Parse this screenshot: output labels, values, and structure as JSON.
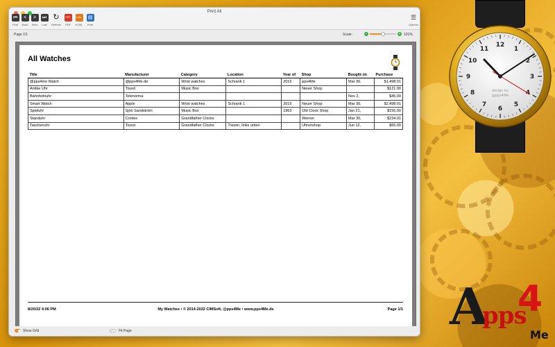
{
  "window": {
    "title": "Print All"
  },
  "toolbar": {
    "buttons": [
      {
        "label": "First",
        "icon": "first-page-icon",
        "glyph": "⏮"
      },
      {
        "label": "Back",
        "icon": "previous-page-icon",
        "glyph": "<"
      },
      {
        "label": "Next",
        "icon": "next-page-icon",
        "glyph": ">"
      },
      {
        "label": "Last",
        "icon": "last-page-icon",
        "glyph": "⏭"
      },
      {
        "label": "Refresh",
        "icon": "refresh-icon",
        "glyph": "↻"
      },
      {
        "label": "PDF",
        "icon": "pdf-icon",
        "glyph": "PDF"
      },
      {
        "label": "HTML",
        "icon": "html-icon",
        "glyph": "HTML"
      },
      {
        "label": "Print",
        "icon": "printer-icon",
        "glyph": "▤"
      }
    ],
    "options_label": "Options"
  },
  "infobar": {
    "page_label": "Page  1/1",
    "scale_label": "Scale:",
    "zoom_minus": "−",
    "zoom_plus": "+",
    "zoom_level": 101,
    "zoom_value": "101%"
  },
  "report": {
    "title": "All Watches",
    "columns": [
      "Title",
      "Manufacturer",
      "Category",
      "Location",
      "Year of",
      "Shop",
      "Bought on",
      "Purchase"
    ],
    "rows": [
      [
        "@pps4me Watch",
        "@pps4Me.de",
        "Wrist watches",
        "Schrank 1",
        "2015",
        "pps4Me",
        "Mar 30,",
        "$1,498.01"
      ],
      [
        "Antike Uhr",
        "Tissot",
        "Music Box",
        "",
        "",
        "Neuer Shop",
        "",
        "$121.00"
      ],
      [
        "Bahnhofsuhr",
        "Telenorma",
        "",
        "",
        "",
        "",
        "Nov 2,",
        "$45.00"
      ],
      [
        "Smart Watch",
        "Apple",
        "Wrist watches",
        "Schrank 1",
        "2015",
        "Neuer Shop",
        "Mar 30,",
        "$2,498.01"
      ],
      [
        "Spieluhr",
        "Sjöö Sandström",
        "Music Box",
        "",
        "1963",
        "Old Clock Shop",
        "Jan 21,",
        "$155.00"
      ],
      [
        "Standuhr",
        "Contex",
        "Grandfather Clocks",
        "",
        "",
        "Werner",
        "Mar 30,",
        "$234.01"
      ],
      [
        "Taschenuhr",
        "Tissot",
        "Grandfather Clocks",
        "Tresen, links unten",
        "",
        "Uhrenshop",
        "Jun 12,",
        "$65.00"
      ]
    ],
    "footer": {
      "date": "8/20/22 4:06 PM",
      "center": "My Watches  •  © 2014-2022 CIMSoft, @pps4Me  •  www.pps4Me.de",
      "page": "Page 1/1"
    }
  },
  "bottombar": {
    "show_grid_label": "Show Grid",
    "show_grid_on": true,
    "fit_page_label": "Fit Page",
    "fit_page_on": false
  },
  "watch": {
    "numbers": [
      "12",
      "1",
      "2",
      "3",
      "4",
      "5",
      "6",
      "7",
      "8",
      "9",
      "10",
      "11"
    ],
    "credit_line1": "design by",
    "credit_line2": "@pps4Me"
  },
  "logo": {
    "a": "A",
    "pps": "pps",
    "four": "4",
    "me": "Me"
  },
  "colors": {
    "accent": "#f08a1e",
    "gold": "#e9a514",
    "logo_red": "#d81414"
  }
}
